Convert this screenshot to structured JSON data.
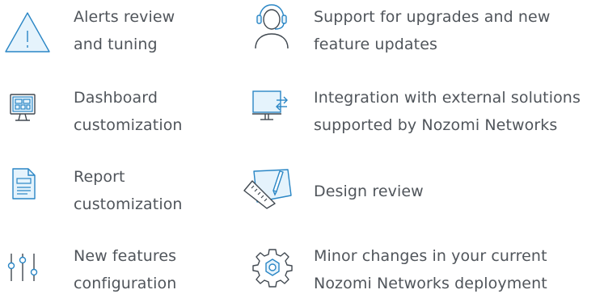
{
  "colors": {
    "icon_stroke": "#2a86c5",
    "icon_fill": "#e5f3fc",
    "icon_dark": "#404850",
    "text": "#50555b"
  },
  "features": {
    "left": [
      {
        "label": "Alerts review\nand tuning",
        "icon": "warning-triangle-icon"
      },
      {
        "label": "Dashboard\ncustomization",
        "icon": "dashboard-monitor-icon"
      },
      {
        "label": "Report\ncustomization",
        "icon": "report-document-icon"
      },
      {
        "label": "New features\nconfiguration",
        "icon": "sliders-icon"
      }
    ],
    "right": [
      {
        "label": "Support for upgrades and new\nfeature updates",
        "icon": "headset-support-icon"
      },
      {
        "label": "Integration with external solutions\nsupported by Nozomi Networks",
        "icon": "monitor-integration-icon"
      },
      {
        "label": "Design review",
        "icon": "design-ruler-icon"
      },
      {
        "label": "Minor changes in your current\nNozomi Networks deployment",
        "icon": "gear-icon"
      }
    ]
  }
}
